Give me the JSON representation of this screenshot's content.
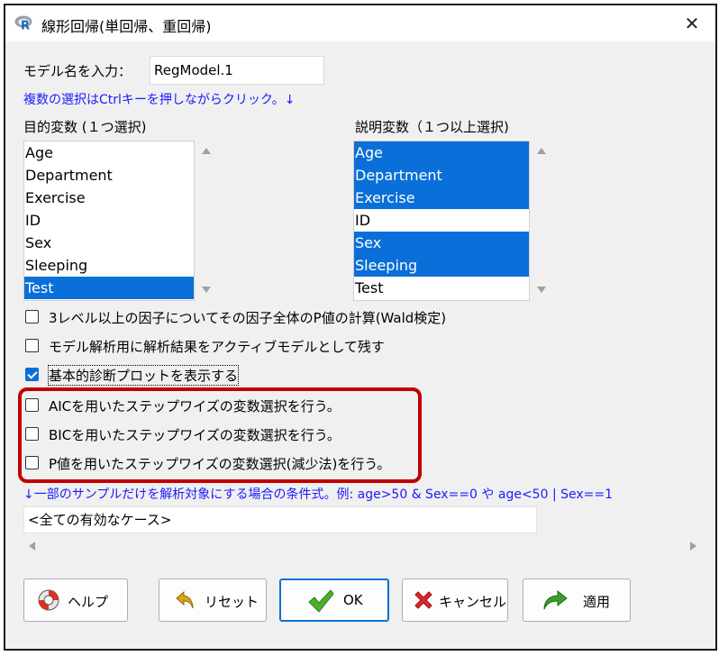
{
  "window": {
    "title": "線形回帰(単回帰、重回帰)"
  },
  "model_name": {
    "label": "モデル名を入力：",
    "value": "RegModel.1"
  },
  "hint": "複数の選択はCtrlキーを押しながらクリック。↓",
  "response": {
    "label": "目的変数 (１つ選択)",
    "items": [
      {
        "text": "Age",
        "selected": false
      },
      {
        "text": "Department",
        "selected": false
      },
      {
        "text": "Exercise",
        "selected": false
      },
      {
        "text": "ID",
        "selected": false
      },
      {
        "text": "Sex",
        "selected": false
      },
      {
        "text": "Sleeping",
        "selected": false
      },
      {
        "text": "Test",
        "selected": true
      }
    ]
  },
  "explanatory": {
    "label": "説明変数（１つ以上選択)",
    "items": [
      {
        "text": "Age",
        "selected": true
      },
      {
        "text": "Department",
        "selected": true
      },
      {
        "text": "Exercise",
        "selected": true
      },
      {
        "text": "ID",
        "selected": false
      },
      {
        "text": "Sex",
        "selected": true
      },
      {
        "text": "Sleeping",
        "selected": true
      },
      {
        "text": "Test",
        "selected": false
      }
    ]
  },
  "options": [
    {
      "label": "3レベル以上の因子についてその因子全体のP値の計算(Wald検定)",
      "checked": false
    },
    {
      "label": "モデル解析用に解析結果をアクティブモデルとして残す",
      "checked": false
    },
    {
      "label": "基本的診断プロットを表示する",
      "checked": true
    },
    {
      "label": "AICを用いたステップワイズの変数選択を行う。",
      "checked": false
    },
    {
      "label": "BICを用いたステップワイズの変数選択を行う。",
      "checked": false
    },
    {
      "label": "P値を用いたステップワイズの変数選択(減少法)を行う。",
      "checked": false
    }
  ],
  "subset": {
    "label": "↓一部のサンプルだけを解析対象にする場合の条件式。例: age>50 & Sex==0 や age<50 | Sex==1",
    "value": "<全ての有効なケース>"
  },
  "buttons": {
    "help": "ヘルプ",
    "reset": "リセット",
    "ok": "OK",
    "cancel": "キャンセル",
    "apply": "適用"
  },
  "colors": {
    "selection": "#0a6fd8",
    "highlight_frame": "#c00000",
    "hint_text": "#1a1aff"
  }
}
